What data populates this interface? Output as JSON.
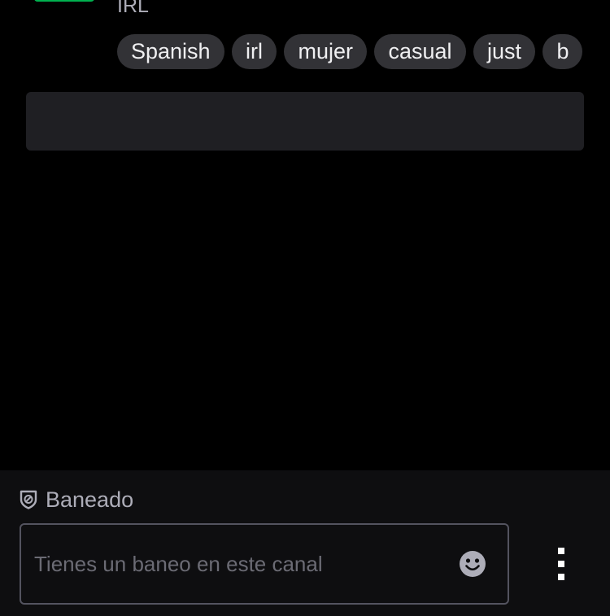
{
  "stream": {
    "category": "IRL",
    "tags": [
      "Spanish",
      "irl",
      "mujer",
      "casual",
      "just",
      "b"
    ]
  },
  "chat": {
    "ban_label": "Baneado",
    "input_placeholder": "Tienes un baneo en este canal"
  },
  "icons": {
    "ban": "shield-slash-icon",
    "emote": "smiley-icon",
    "more": "vertical-dots-icon"
  },
  "colors": {
    "background": "#000000",
    "tag_background": "#323236",
    "panel_background": "#1f1f23",
    "footer_background": "#0e0e10",
    "muted_text": "#adadb8",
    "avatar_live_border": "#00b14f"
  }
}
